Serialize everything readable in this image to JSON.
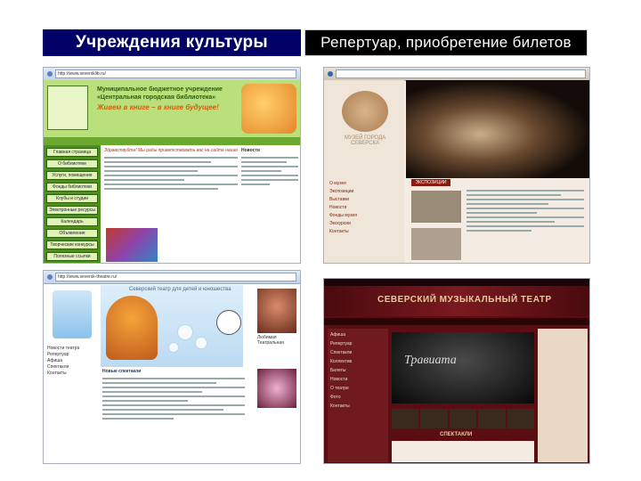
{
  "headers": {
    "left": "Учреждения культуры",
    "right": "Репертуар, приобретение билетов"
  },
  "screens": {
    "library": {
      "url": "http://www.seversklib.ru/",
      "title": "Муниципальное бюджетное учреждение «Центральная городская библиотека»",
      "slogan": "Живем в книге – в книге будущее!",
      "nav": [
        "Главная страница",
        "О библиотеке",
        "Услуги, помещения",
        "Фонды библиотеки",
        "Клубы и студии",
        "Электронные ресурсы",
        "Календарь",
        "Объявления",
        "Творческие конкурсы",
        "Полезные ссылки"
      ],
      "welcome": "Здравствуйте! Мы рады приветствовать вас на сайте нашей библиотеки!",
      "news": "Новости"
    },
    "museum": {
      "title": "МУЗЕЙ ГОРОДА СЕВЕРСКА",
      "menu": [
        "О музее",
        "Экспозиции",
        "Выставки",
        "Новости",
        "Фонды музея",
        "Экскурсии",
        "Контакты"
      ],
      "tab": "ЭКСПОЗИЦИИ"
    },
    "theater_children": {
      "url": "http://www.seversk-theatre.ru/",
      "title": "Северский театр для детей и юношества",
      "caption": "Любимая Театральная",
      "nav": [
        "Новости театра",
        "Репертуар",
        "Афиша",
        "Спектакли",
        "Контакты"
      ],
      "headline": "Новые спектакли"
    },
    "music_theater": {
      "title": "СЕВЕРСКИЙ МУЗЫКАЛЬНЫЙ ТЕАТР",
      "poster": "Травиата",
      "menu": [
        "Афиша",
        "Репертуар",
        "Спектакли",
        "Коллектив",
        "Билеты",
        "Новости",
        "О театре",
        "Фото",
        "Контакты"
      ],
      "section": "СПЕКТАКЛИ"
    }
  }
}
